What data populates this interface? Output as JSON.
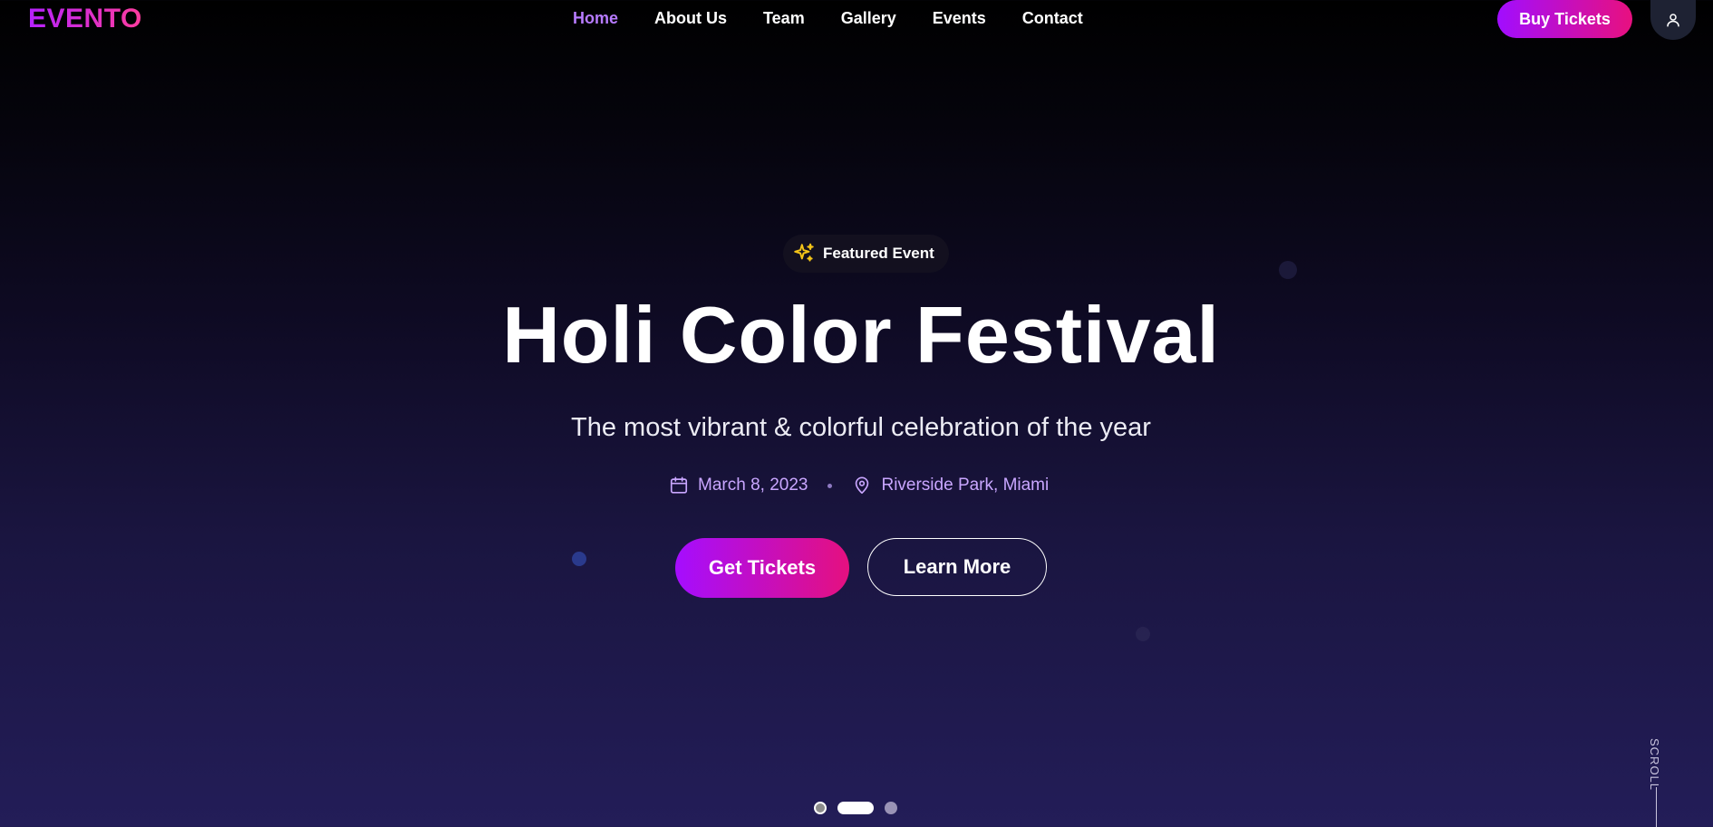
{
  "brand": {
    "logo": "EVENTO"
  },
  "nav": {
    "links": [
      {
        "label": "Home",
        "active": true
      },
      {
        "label": "About Us",
        "active": false
      },
      {
        "label": "Team",
        "active": false
      },
      {
        "label": "Gallery",
        "active": false
      },
      {
        "label": "Events",
        "active": false
      },
      {
        "label": "Contact",
        "active": false
      }
    ],
    "buy_label": "Buy Tickets",
    "user_icon": "user-icon"
  },
  "hero": {
    "badge_icon": "sparkles-icon",
    "badge_label": "Featured Event",
    "title": "Holi Color Festival",
    "subtitle": "The most vibrant & colorful celebration of the year",
    "date_icon": "calendar-icon",
    "date": "March 8, 2023",
    "location_icon": "map-pin-icon",
    "location": "Riverside Park, Miami",
    "primary_cta": "Get Tickets",
    "secondary_cta": "Learn More"
  },
  "scroll_label": "SCROLL",
  "carousel": {
    "slide_count": 3,
    "active_index": 1
  },
  "colors": {
    "accent": "#b77bff",
    "gradient_start": "#a10dff",
    "gradient_end": "#e8107f",
    "badge_icon": "#f5c518"
  }
}
